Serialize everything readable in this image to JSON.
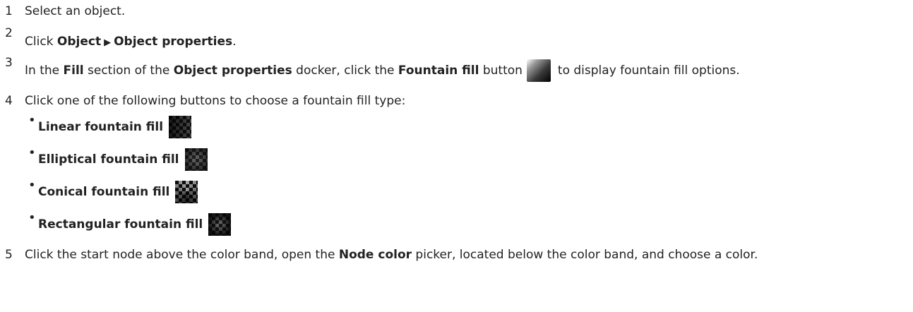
{
  "steps": [
    {
      "num": "1",
      "text": "Select an object."
    },
    {
      "num": "2",
      "pre": "Click ",
      "menu1": "Object",
      "menu2": "Object properties",
      "post": "."
    },
    {
      "num": "3",
      "p1": "In the ",
      "b1": "Fill",
      "p2": " section of the ",
      "b2": "Object properties",
      "p3": " docker, click the ",
      "b3": "Fountain fill",
      "p4": " button",
      "p5": "to display fountain fill options."
    },
    {
      "num": "4",
      "text": "Click one of the following buttons to choose a fountain fill type:"
    },
    {
      "num": "5",
      "p1": "Click the start node above the color band, open the ",
      "b1": "Node color",
      "p2": " picker, located below the color band, and choose a color."
    }
  ],
  "fill_types": [
    {
      "label": "Linear fountain fill",
      "icon": "linear-fountain-fill-icon"
    },
    {
      "label": "Elliptical fountain fill",
      "icon": "elliptical-fountain-fill-icon"
    },
    {
      "label": "Conical fountain fill",
      "icon": "conical-fountain-fill-icon"
    },
    {
      "label": "Rectangular fountain fill",
      "icon": "rectangular-fountain-fill-icon"
    }
  ],
  "bullet": "•",
  "arrow": "▶"
}
